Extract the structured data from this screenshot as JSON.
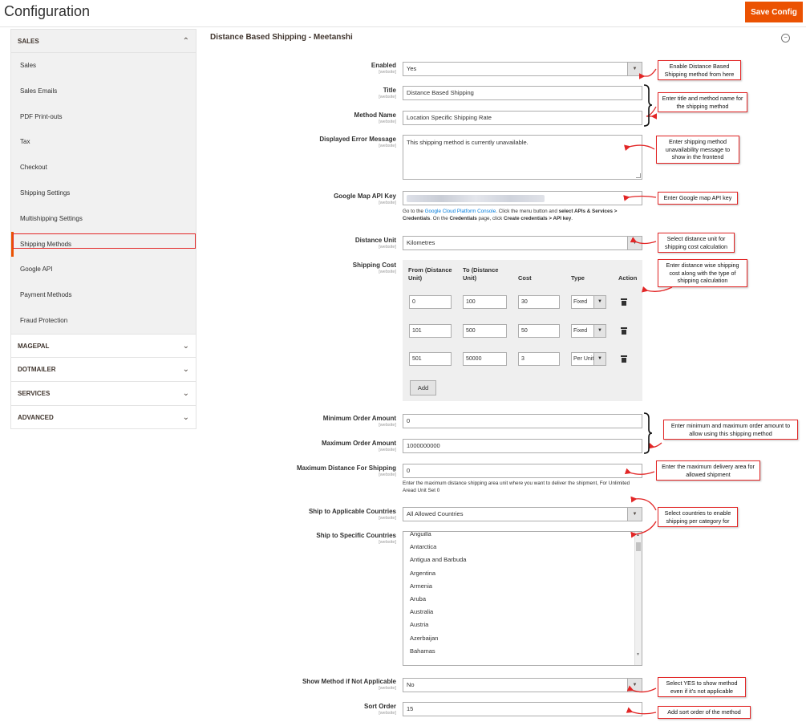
{
  "header": {
    "title": "Configuration",
    "save_label": "Save Config"
  },
  "accent_color": "#eb5202",
  "callout_border_color": "#e22626",
  "sidebar": {
    "open_section": "SALES",
    "items": [
      {
        "label": "Sales",
        "active": false
      },
      {
        "label": "Sales Emails",
        "active": false
      },
      {
        "label": "PDF Print-outs",
        "active": false
      },
      {
        "label": "Tax",
        "active": false
      },
      {
        "label": "Checkout",
        "active": false
      },
      {
        "label": "Shipping Settings",
        "active": false
      },
      {
        "label": "Multishipping Settings",
        "active": false
      },
      {
        "label": "Shipping Methods",
        "active": true
      },
      {
        "label": "Google API",
        "active": false
      },
      {
        "label": "Payment Methods",
        "active": false
      },
      {
        "label": "Fraud Protection",
        "active": false
      }
    ],
    "collapsed_sections": [
      "MAGEPAL",
      "DOTMAILER",
      "SERVICES",
      "ADVANCED"
    ]
  },
  "group_title": "Distance Based Shipping - Meetanshi",
  "scope": "[website]",
  "fields": {
    "enabled": {
      "label": "Enabled",
      "value": "Yes"
    },
    "title": {
      "label": "Title",
      "value": "Distance Based Shipping"
    },
    "method_name": {
      "label": "Method Name",
      "value": "Location Specific Shipping Rate"
    },
    "error_message": {
      "label": "Displayed Error Message",
      "value": "This shipping method is currently unavailable."
    },
    "api_key": {
      "label": "Google Map API Key"
    },
    "api_note": {
      "p1": "Go to the ",
      "link": "Google Cloud Platform Console",
      "p2": ". Click the menu button and ",
      "b1": "select APIs & Services > Credentials",
      "p3": ". On the ",
      "b2": "Credentials",
      "p4": " page, click ",
      "b3": "Create credentials > API key",
      "p5": "."
    },
    "distance_unit": {
      "label": "Distance Unit",
      "value": "Kilometres"
    },
    "shipping_cost": {
      "label": "Shipping Cost"
    },
    "min_order": {
      "label": "Minimum Order Amount",
      "value": "0"
    },
    "max_order": {
      "label": "Maximum Order Amount",
      "value": "1000000000"
    },
    "max_distance": {
      "label": "Maximum Distance For Shipping",
      "value": "0"
    },
    "max_distance_note": "Enter the maximum distance shipping area unit where you want to deliver the shipment, For Unlimited Aread Unit Set 0",
    "applicable_countries": {
      "label": "Ship to Applicable Countries",
      "value": "All Allowed Countries"
    },
    "specific_countries": {
      "label": "Ship to Specific Countries"
    },
    "show_method": {
      "label": "Show Method if Not Applicable",
      "value": "No"
    },
    "sort_order": {
      "label": "Sort Order",
      "value": "15"
    }
  },
  "cost_table": {
    "headers": {
      "from": "From (Distance Unit)",
      "to": "To (Distance Unit)",
      "cost": "Cost",
      "type": "Type",
      "action": "Action"
    },
    "rows": [
      {
        "from": "0",
        "to": "100",
        "cost": "30",
        "type": "Fixed"
      },
      {
        "from": "101",
        "to": "500",
        "cost": "50",
        "type": "Fixed"
      },
      {
        "from": "501",
        "to": "50000",
        "cost": "3",
        "type": "Per Unit"
      }
    ],
    "add_label": "Add"
  },
  "countries": [
    "Anguilla",
    "Antarctica",
    "Antigua and Barbuda",
    "Argentina",
    "Armenia",
    "Aruba",
    "Australia",
    "Austria",
    "Azerbaijan",
    "Bahamas"
  ],
  "callouts": {
    "enable": "Enable Distance Based Shipping method from here",
    "title_name": "Enter title and method name for the shipping method",
    "error": "Enter shipping method unavailability message to show in the frontend",
    "api": "Enter Google map API key",
    "unit": "Select distance unit for shipping cost calculation",
    "cost": "Enter distance wise shipping cost along with the type of shipping calculation",
    "order": "Enter minimum and maximum order amount to allow using this shipping method",
    "distance": "Enter the maximum delivery area for allowed shipment",
    "countries": "Select countries to enable shipping per category for",
    "show": "Select YES to show method even if it's not applicable",
    "sort": "Add sort order of the method"
  },
  "icons": {
    "collapse": "circle-minus-icon",
    "select_arrow": "caret-down-icon",
    "delete": "trash-icon",
    "chevron_up": "chevron-up-icon",
    "chevron_down": "chevron-down-icon"
  }
}
